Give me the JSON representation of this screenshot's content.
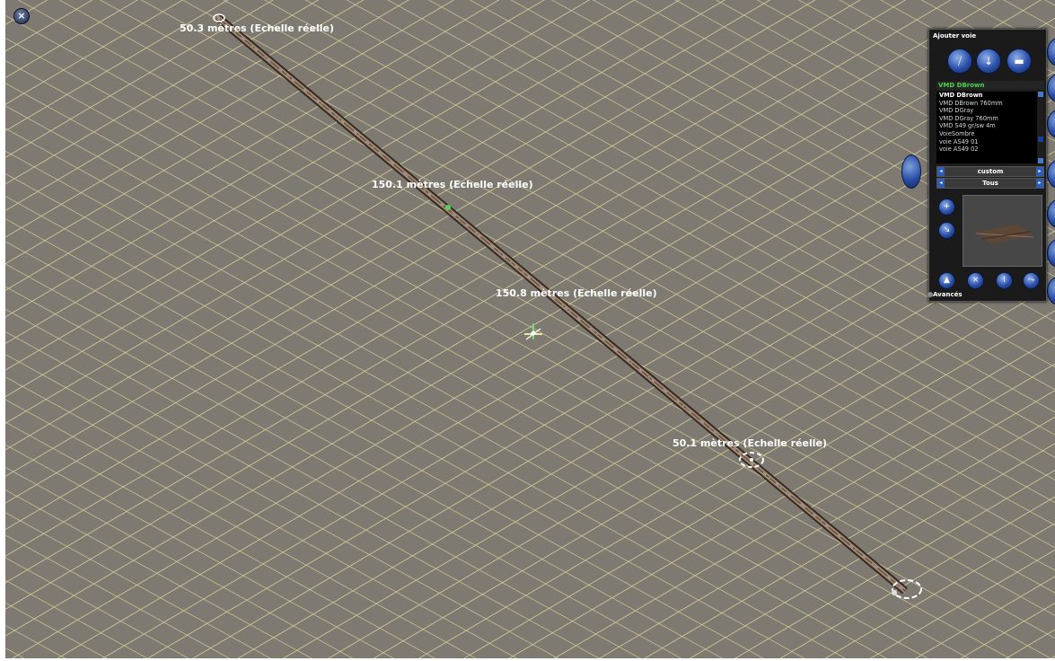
{
  "measurements": [
    {
      "text": "50.3 mètres  (Echelle réelle)"
    },
    {
      "text": "150.1 mètres  (Echelle réelle)"
    },
    {
      "text": "150.8 mètres  (Echelle réelle)"
    },
    {
      "text": "50.1 mètres  (Echelle réelle)"
    }
  ],
  "panel": {
    "title": "Ajouter voie",
    "selected_track": "VMD DBrown",
    "track_list": [
      "VMD DBrown",
      "VMD DBrown 760mm",
      "VMD DGray",
      "VMD DGray 760mm",
      "VMD S49 gr/sw 4m",
      "VoieSombre",
      "voie AS49 01",
      "voie AS49 02"
    ],
    "filter_style": "custom",
    "filter_category": "Tous",
    "footer": "Avancés"
  },
  "icons": {
    "close": "×"
  },
  "colors": {
    "ground": "#7e7a72",
    "grid": "#d9cf9a",
    "track": "#5a4636",
    "panel_bg": "#1a1a1a",
    "selected_text": "#4cd44c",
    "button_blue": "#2a4fa8"
  }
}
